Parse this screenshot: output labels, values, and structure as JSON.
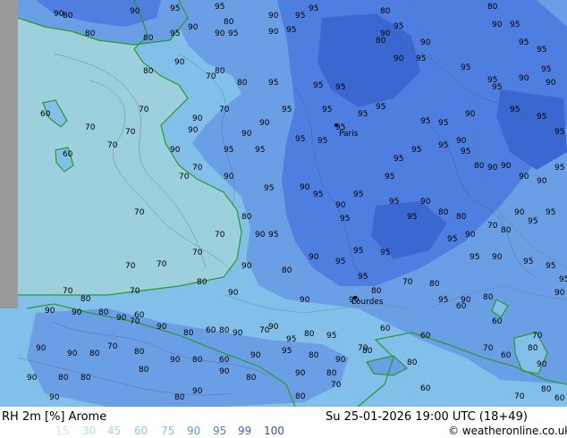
{
  "map": {
    "product": "RH 2m [%]",
    "model": "Arome",
    "valid_time": "Su 25-01-2026 19:00 UTC (18+49)",
    "credit": "© weatheronline.co.uk",
    "place_names": [
      "Paris",
      "Lourdes"
    ],
    "colors": {
      "sea": "#9cd0dc",
      "land_70": "#a8d8e8",
      "land_80": "#82c0ea",
      "land_90": "#6a9fe6",
      "land_95": "#4d7ee0",
      "land_99": "#3a68d0",
      "coast": "#2a9a2a",
      "contour": "#404860",
      "frame_left": "#9a9a9a"
    }
  },
  "contour_labels": [
    [
      "90",
      60,
      18
    ],
    [
      "90",
      145,
      15
    ],
    [
      "95",
      190,
      12
    ],
    [
      "95",
      240,
      10
    ],
    [
      "80",
      250,
      27
    ],
    [
      "90",
      210,
      33
    ],
    [
      "95",
      190,
      40
    ],
    [
      "90",
      240,
      40
    ],
    [
      "95",
      255,
      40
    ],
    [
      "90",
      300,
      38
    ],
    [
      "95",
      320,
      36
    ],
    [
      "95",
      330,
      20
    ],
    [
      "95",
      345,
      12
    ],
    [
      "90",
      300,
      20
    ],
    [
      "80",
      425,
      15
    ],
    [
      "95",
      440,
      32
    ],
    [
      "90",
      425,
      40
    ],
    [
      "80",
      420,
      48
    ],
    [
      "90",
      440,
      68
    ],
    [
      "95",
      465,
      68
    ],
    [
      "90",
      470,
      50
    ],
    [
      "95",
      515,
      78
    ],
    [
      "80",
      545,
      10
    ],
    [
      "90",
      550,
      30
    ],
    [
      "95",
      570,
      30
    ],
    [
      "95",
      580,
      50
    ],
    [
      "95",
      600,
      58
    ],
    [
      "95",
      545,
      92
    ],
    [
      "95",
      550,
      100
    ],
    [
      "90",
      580,
      90
    ],
    [
      "95",
      605,
      80
    ],
    [
      "90",
      610,
      95
    ],
    [
      "80",
      70,
      20
    ],
    [
      "80",
      95,
      40
    ],
    [
      "80",
      160,
      45
    ],
    [
      "90",
      195,
      72
    ],
    [
      "80",
      240,
      82
    ],
    [
      "80",
      265,
      95
    ],
    [
      "70",
      230,
      88
    ],
    [
      "95",
      300,
      95
    ],
    [
      "95",
      350,
      98
    ],
    [
      "95",
      375,
      100
    ],
    [
      "80",
      160,
      82
    ],
    [
      "90",
      215,
      135
    ],
    [
      "70",
      245,
      125
    ],
    [
      "70",
      155,
      125
    ],
    [
      "70",
      140,
      150
    ],
    [
      "70",
      120,
      165
    ],
    [
      "70",
      95,
      145
    ],
    [
      "60",
      45,
      130
    ],
    [
      "60",
      70,
      175
    ],
    [
      "90",
      190,
      170
    ],
    [
      "90",
      210,
      148
    ],
    [
      "90",
      270,
      152
    ],
    [
      "95",
      285,
      170
    ],
    [
      "95",
      330,
      158
    ],
    [
      "95",
      355,
      160
    ],
    [
      "95",
      375,
      145
    ],
    [
      "95",
      400,
      130
    ],
    [
      "95",
      420,
      122
    ],
    [
      "95",
      250,
      170
    ],
    [
      "90",
      290,
      140
    ],
    [
      "95",
      315,
      125
    ],
    [
      "95",
      360,
      125
    ],
    [
      "95",
      470,
      138
    ],
    [
      "95",
      490,
      140
    ],
    [
      "90",
      520,
      130
    ],
    [
      "95",
      570,
      125
    ],
    [
      "95",
      600,
      133
    ],
    [
      "95",
      620,
      150
    ],
    [
      "70",
      200,
      200
    ],
    [
      "70",
      215,
      190
    ],
    [
      "90",
      250,
      200
    ],
    [
      "95",
      295,
      213
    ],
    [
      "90",
      335,
      212
    ],
    [
      "95",
      350,
      220
    ],
    [
      "95",
      395,
      220
    ],
    [
      "95",
      430,
      200
    ],
    [
      "95",
      440,
      180
    ],
    [
      "95",
      460,
      170
    ],
    [
      "95",
      490,
      165
    ],
    [
      "90",
      510,
      160
    ],
    [
      "95",
      515,
      172
    ],
    [
      "80",
      530,
      188
    ],
    [
      "90",
      545,
      190
    ],
    [
      "90",
      560,
      188
    ],
    [
      "90",
      580,
      200
    ],
    [
      "90",
      600,
      205
    ],
    [
      "95",
      620,
      190
    ],
    [
      "70",
      150,
      240
    ],
    [
      "70",
      240,
      265
    ],
    [
      "80",
      270,
      245
    ],
    [
      "90",
      285,
      265
    ],
    [
      "95",
      300,
      265
    ],
    [
      "90",
      375,
      232
    ],
    [
      "95",
      380,
      247
    ],
    [
      "95",
      435,
      228
    ],
    [
      "95",
      455,
      245
    ],
    [
      "90",
      470,
      228
    ],
    [
      "80",
      490,
      240
    ],
    [
      "80",
      510,
      245
    ],
    [
      "70",
      545,
      255
    ],
    [
      "80",
      560,
      260
    ],
    [
      "90",
      575,
      240
    ],
    [
      "95",
      590,
      250
    ],
    [
      "95",
      610,
      240
    ],
    [
      "70",
      140,
      300
    ],
    [
      "70",
      175,
      298
    ],
    [
      "70",
      215,
      285
    ],
    [
      "90",
      270,
      300
    ],
    [
      "80",
      315,
      305
    ],
    [
      "90",
      345,
      290
    ],
    [
      "95",
      375,
      295
    ],
    [
      "95",
      395,
      283
    ],
    [
      "95",
      425,
      285
    ],
    [
      "95",
      500,
      270
    ],
    [
      "90",
      520,
      265
    ],
    [
      "95",
      525,
      290
    ],
    [
      "90",
      550,
      290
    ],
    [
      "95",
      585,
      295
    ],
    [
      "95",
      610,
      300
    ],
    [
      "95",
      625,
      315
    ],
    [
      "90",
      620,
      330
    ],
    [
      "70",
      70,
      328
    ],
    [
      "80",
      90,
      337
    ],
    [
      "70",
      145,
      328
    ],
    [
      "80",
      220,
      318
    ],
    [
      "90",
      255,
      330
    ],
    [
      "90",
      335,
      338
    ],
    [
      "90",
      390,
      338
    ],
    [
      "95",
      400,
      312
    ],
    [
      "80",
      415,
      328
    ],
    [
      "70",
      450,
      318
    ],
    [
      "80",
      480,
      320
    ],
    [
      "95",
      490,
      338
    ],
    [
      "90",
      515,
      338
    ],
    [
      "80",
      540,
      335
    ],
    [
      "60",
      510,
      345
    ],
    [
      "90",
      50,
      350
    ],
    [
      "90",
      80,
      352
    ],
    [
      "80",
      110,
      352
    ],
    [
      "90",
      130,
      358
    ],
    [
      "70",
      145,
      362
    ],
    [
      "60",
      150,
      355
    ],
    [
      "90",
      175,
      368
    ],
    [
      "80",
      205,
      375
    ],
    [
      "60",
      230,
      372
    ],
    [
      "80",
      245,
      372
    ],
    [
      "90",
      260,
      375
    ],
    [
      "70",
      290,
      372
    ],
    [
      "90",
      300,
      368
    ],
    [
      "95",
      320,
      382
    ],
    [
      "80",
      340,
      376
    ],
    [
      "95",
      365,
      378
    ],
    [
      "70",
      400,
      392
    ],
    [
      "60",
      425,
      370
    ],
    [
      "60",
      470,
      378
    ],
    [
      "60",
      550,
      362
    ],
    [
      "70",
      595,
      378
    ],
    [
      "80",
      590,
      392
    ],
    [
      "90",
      600,
      410
    ],
    [
      "90",
      40,
      392
    ],
    [
      "90",
      75,
      398
    ],
    [
      "80",
      100,
      398
    ],
    [
      "70",
      120,
      390
    ],
    [
      "80",
      150,
      396
    ],
    [
      "90",
      190,
      405
    ],
    [
      "80",
      215,
      405
    ],
    [
      "60",
      245,
      405
    ],
    [
      "90",
      280,
      400
    ],
    [
      "95",
      315,
      395
    ],
    [
      "80",
      345,
      400
    ],
    [
      "90",
      375,
      405
    ],
    [
      "80",
      405,
      395
    ],
    [
      "80",
      455,
      408
    ],
    [
      "70",
      540,
      392
    ],
    [
      "60",
      560,
      400
    ],
    [
      "90",
      30,
      425
    ],
    [
      "80",
      65,
      425
    ],
    [
      "80",
      90,
      425
    ],
    [
      "80",
      155,
      416
    ],
    [
      "90",
      245,
      418
    ],
    [
      "80",
      275,
      425
    ],
    [
      "90",
      330,
      420
    ],
    [
      "80",
      365,
      420
    ],
    [
      "70",
      370,
      433
    ],
    [
      "60",
      470,
      437
    ],
    [
      "70",
      575,
      446
    ],
    [
      "80",
      605,
      438
    ],
    [
      "60",
      620,
      448
    ],
    [
      "90",
      55,
      447
    ],
    [
      "80",
      195,
      447
    ],
    [
      "90",
      215,
      440
    ],
    [
      "80",
      330,
      446
    ]
  ]
}
